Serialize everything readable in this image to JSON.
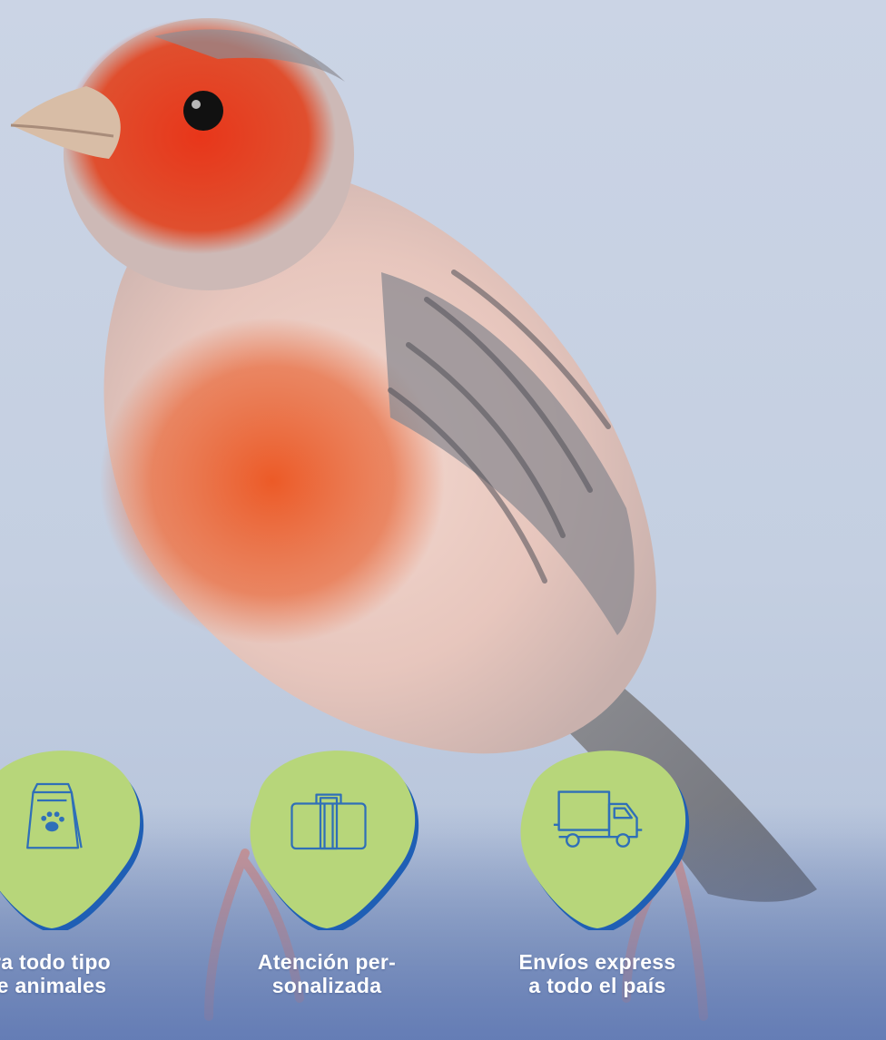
{
  "photo": {
    "subject": "bird-icon",
    "colors": {
      "background": "#c9d3e4",
      "head_red": "#e43b1c",
      "breast_orange": "#e9642f",
      "plumage_grey": "#9a9a9c",
      "badge_green": "#b7d67a",
      "badge_shadow": "#1f5fb5",
      "icon_blue": "#2f6fb8",
      "label_text": "#ffffff"
    }
  },
  "features": [
    {
      "icon": "pet-food-bag-icon",
      "label": "ra todo tipo\ne animales"
    },
    {
      "icon": "briefcase-icon",
      "label": "Atención per-\nsonalizada"
    },
    {
      "icon": "delivery-truck-icon",
      "label": "Envíos express\na todo el país"
    }
  ]
}
